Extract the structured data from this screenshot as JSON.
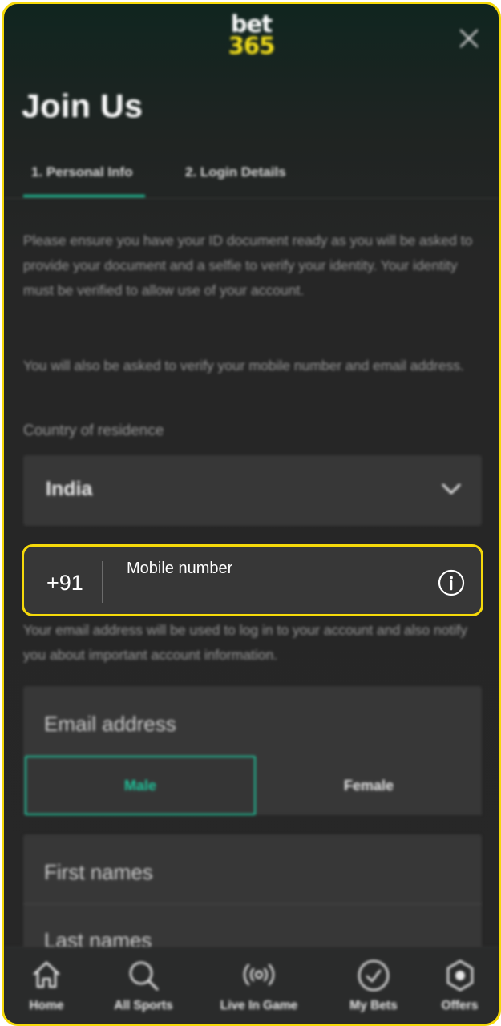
{
  "brand": {
    "logo_top": "bet",
    "logo_bottom": "365",
    "accent": "#1fc29a",
    "highlight": "#f5d90a",
    "logo_yellow": "#f3df1a"
  },
  "header": {
    "title": "Join Us",
    "close_icon": "close-icon"
  },
  "tabs": [
    {
      "label": "1.  Personal Info",
      "active": true
    },
    {
      "label": "2.  Login Details",
      "active": false
    }
  ],
  "intro": {
    "p1": "Please ensure you have your ID document ready as you will be asked to provide your document and a selfie to verify your identity. Your identity must be verified to allow use of your account.",
    "p2": "You will also be asked to verify your mobile number and email address."
  },
  "country": {
    "label": "Country of residence",
    "value": "India",
    "icon": "chevron-down-icon"
  },
  "mobile": {
    "code": "+91",
    "label": "Mobile number",
    "icon": "info-icon"
  },
  "email": {
    "helper": "Your email address will be used to log in to your account and also notify you about important account information.",
    "placeholder": "Email address"
  },
  "gender": {
    "options": [
      "Male",
      "Female"
    ],
    "selected": "Male"
  },
  "names": {
    "first_placeholder": "First names",
    "last_placeholder": "Last names"
  },
  "bottom_nav": [
    {
      "label": "Home",
      "icon": "home-icon"
    },
    {
      "label": "All Sports",
      "icon": "search-icon"
    },
    {
      "label": "Live In Game",
      "icon": "live-broadcast-icon"
    },
    {
      "label": "My Bets",
      "icon": "check-circle-icon"
    },
    {
      "label": "Offers",
      "icon": "offers-icon"
    }
  ]
}
